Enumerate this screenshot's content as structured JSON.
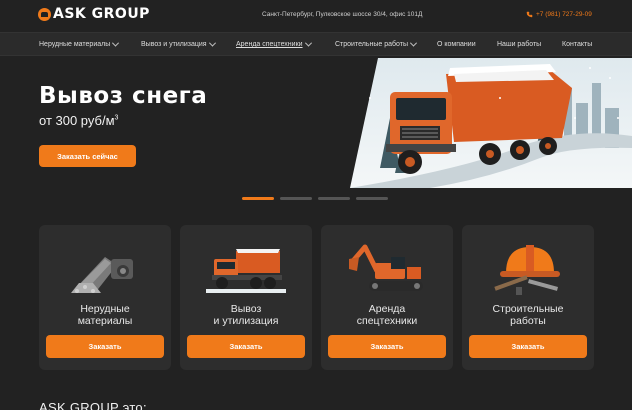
{
  "header": {
    "logo_accent": "",
    "logo_text": "ASK GROUP",
    "address": "Санкт-Петербург, Пулковское шоссе 30/4, офис 101Д",
    "phone": "+7 (981) 727-29-09"
  },
  "nav": {
    "items": [
      {
        "label": "Нерудные материалы",
        "dropdown": true
      },
      {
        "label": "Вывоз и утилизация",
        "dropdown": true
      },
      {
        "label": "Аренда спецтехники",
        "dropdown": true
      },
      {
        "label": "Строительные работы",
        "dropdown": true
      },
      {
        "label": "О компании",
        "dropdown": false
      },
      {
        "label": "Наши работы",
        "dropdown": false
      },
      {
        "label": "Контакты",
        "dropdown": false
      }
    ]
  },
  "hero": {
    "title": "Вывоз снега",
    "price": "от 300 руб/м",
    "price_sup": "3",
    "button": "Заказать сейчас",
    "slides_total": 4,
    "slide_active": 1
  },
  "cards": [
    {
      "line1": "Нерудные",
      "line2": "материалы",
      "button": "Заказать",
      "icon": "crusher-icon"
    },
    {
      "line1": "Вывоз",
      "line2": "и утилизация",
      "button": "Заказать",
      "icon": "dump-truck-icon"
    },
    {
      "line1": "Аренда",
      "line2": "спецтехники",
      "button": "Заказать",
      "icon": "excavator-icon"
    },
    {
      "line1": "Строительные",
      "line2": "работы",
      "button": "Заказать",
      "icon": "hard-hat-icon"
    }
  ],
  "section": {
    "heading": "ASK GROUP это:"
  },
  "colors": {
    "accent": "#f07a1a",
    "background": "#222222",
    "card": "#2d2d2d"
  }
}
